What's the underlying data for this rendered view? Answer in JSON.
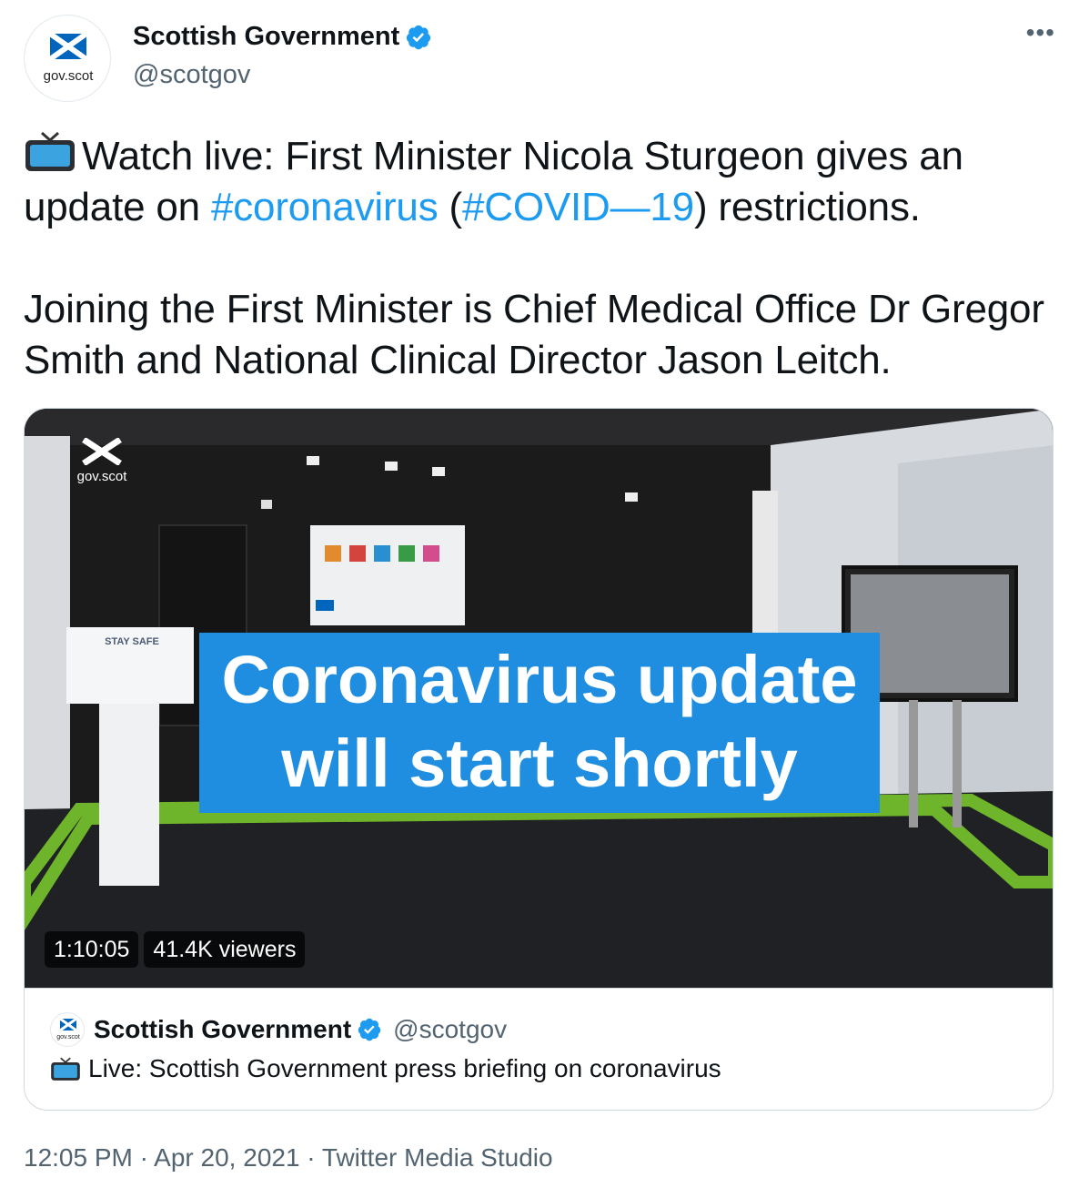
{
  "author": {
    "display_name": "Scottish Government",
    "handle": "@scotgov",
    "avatar_text": "gov.scot",
    "verified": true
  },
  "more_label": "•••",
  "tweet": {
    "line1_prefix": "Watch live: First Minister Nicola Sturgeon gives an",
    "line2_before": "update on ",
    "hashtag1": "#coronavirus",
    "line2_mid": " (",
    "hashtag2": "#COVID—19",
    "line2_after": ") restrictions.",
    "paragraph2": "Joining the First Minister is Chief Medical Office Dr Gregor Smith and National Clinical Director Jason Leitch."
  },
  "video": {
    "banner_line1": "Coronavirus update",
    "banner_line2": "will start shortly",
    "logo_text": "gov.scot",
    "lectern_text": "STAY SAFE",
    "duration": "1:10:05",
    "viewers": "41.4K viewers"
  },
  "card": {
    "author_name": "Scottish Government",
    "author_handle": "@scotgov",
    "avatar_text": "gov.scot",
    "title": "Live: Scottish Government press briefing on coronavirus"
  },
  "meta": {
    "text": "12:05 PM · Apr 20, 2021 · Twitter Media Studio"
  },
  "colors": {
    "accent": "#1d9bf0",
    "banner": "#1f8ee0",
    "flag_blue": "#0065bd",
    "muted": "#536471"
  }
}
